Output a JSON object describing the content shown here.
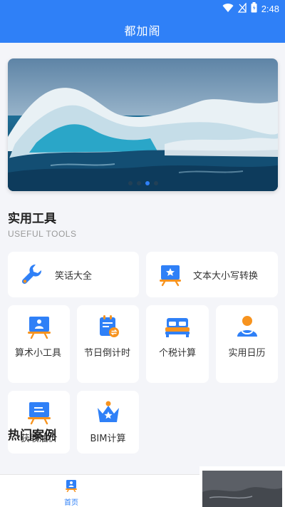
{
  "status_bar": {
    "time": "2:48",
    "icons": [
      "wifi-icon",
      "no-signal-icon",
      "battery-icon"
    ]
  },
  "app_bar": {
    "title": "都加阁"
  },
  "banner": {
    "dots": 4,
    "active_dot": 2
  },
  "section": {
    "title": "实用工具",
    "subtitle": "USEFUL TOOLS"
  },
  "tools": {
    "jokes": {
      "label": "笑话大全",
      "icon": "wrench-icon"
    },
    "text_case": {
      "label": "文本大小写转换",
      "icon": "star-board-icon"
    },
    "arithmetic": {
      "label": "算术小工具",
      "icon": "teacher-board-icon"
    },
    "holiday": {
      "label": "节日倒计时",
      "icon": "calendar-icon"
    },
    "tax": {
      "label": "个税计算",
      "icon": "bed-icon"
    },
    "calendar": {
      "label": "实用日历",
      "icon": "person-icon"
    },
    "oil": {
      "label": "获取油价",
      "icon": "board-icon"
    },
    "bim": {
      "label": "BIM计算",
      "icon": "crown-icon"
    }
  },
  "next_section": {
    "title": "热门案例"
  },
  "bottom_nav": {
    "home_label": "首页"
  },
  "colors": {
    "primary": "#2f80f7",
    "accent": "#f7931e",
    "background": "#f4f5f9"
  }
}
